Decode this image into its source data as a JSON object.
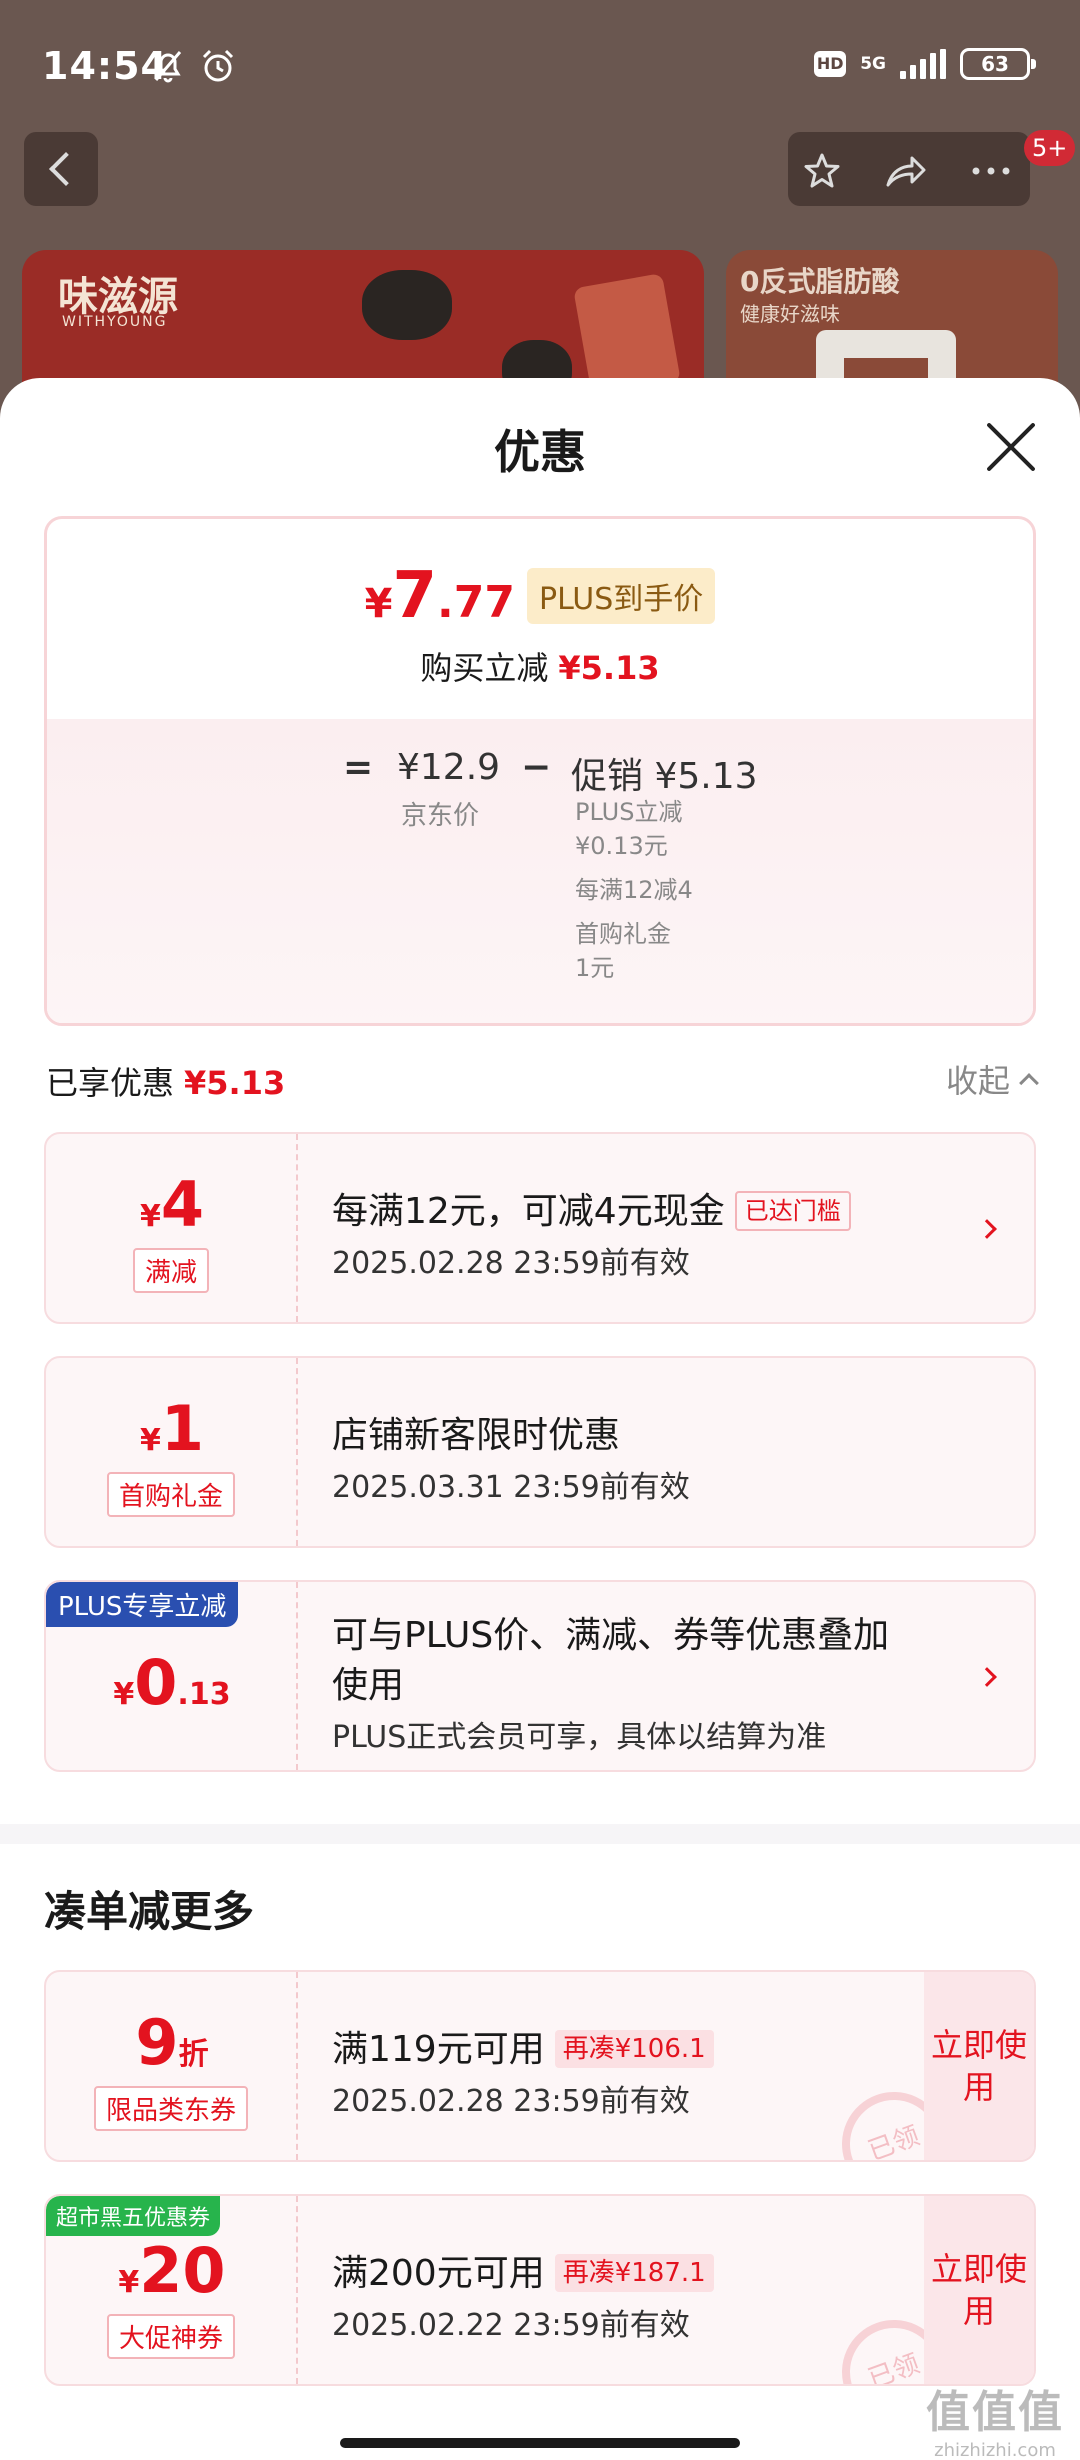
{
  "status_bar": {
    "time": "14:54",
    "hd": "HD",
    "network": "5G",
    "battery": "63"
  },
  "nav": {
    "badge": "5+"
  },
  "background_product": {
    "brand": "味滋源",
    "brand_sub": "WITHYOUNG",
    "card2_title": "0反式脂肪酸",
    "card2_sub": "健康好滋味"
  },
  "sheet": {
    "title": "优惠",
    "final_price": {
      "currency": "¥",
      "integer": "7",
      "decimal": ".77"
    },
    "plus_price_tag": "PLUS到手价",
    "instant_reduce_label": "购买立减",
    "instant_reduce_value": "¥5.13",
    "formula": {
      "equals": "=",
      "jd_price": "¥12.9",
      "jd_price_label": "京东价",
      "minus": "−",
      "promo": "促销 ¥5.13",
      "promo_items": [
        "PLUS立减",
        "¥0.13元",
        "每满12减4",
        "首购礼金",
        "1元"
      ]
    },
    "enjoyed_label": "已享优惠",
    "enjoyed_value": "¥5.13",
    "collapse_label": "收起"
  },
  "coupons": [
    {
      "currency": "¥",
      "amount": "4",
      "tag": "满减",
      "title": "每满12元，可减4元现金",
      "badge": "已达门槛",
      "date": "2025.02.28 23:59前有效"
    },
    {
      "currency": "¥",
      "amount": "1",
      "tag": "首购礼金",
      "title": "店铺新客限时优惠",
      "date": "2025.03.31 23:59前有效"
    },
    {
      "corner": "PLUS专享立减",
      "currency": "¥",
      "amount": "0",
      "decimal": ".13",
      "title_line1": "可与PLUS价、满减、券等优惠叠加",
      "title_line2": "使用",
      "note": "PLUS正式会员可享，具体以结算为准"
    }
  ],
  "more_section": {
    "title": "凑单减更多",
    "items": [
      {
        "amount": "9",
        "unit": "折",
        "tag": "限品类东券",
        "title": "满119元可用",
        "extra": "再凑¥106.1",
        "date": "2025.02.28 23:59前有效",
        "button": "立即使用",
        "stamp": "已领"
      },
      {
        "corner": "超市黑五优惠券",
        "currency": "¥",
        "amount": "20",
        "tag": "大促神券",
        "title": "满200元可用",
        "extra": "再凑¥187.1",
        "date": "2025.02.22 23:59前有效",
        "button": "立即使用",
        "stamp": "已领"
      }
    ]
  },
  "watermark": {
    "main": "值值值",
    "sub": "zhizhizhi.com"
  }
}
